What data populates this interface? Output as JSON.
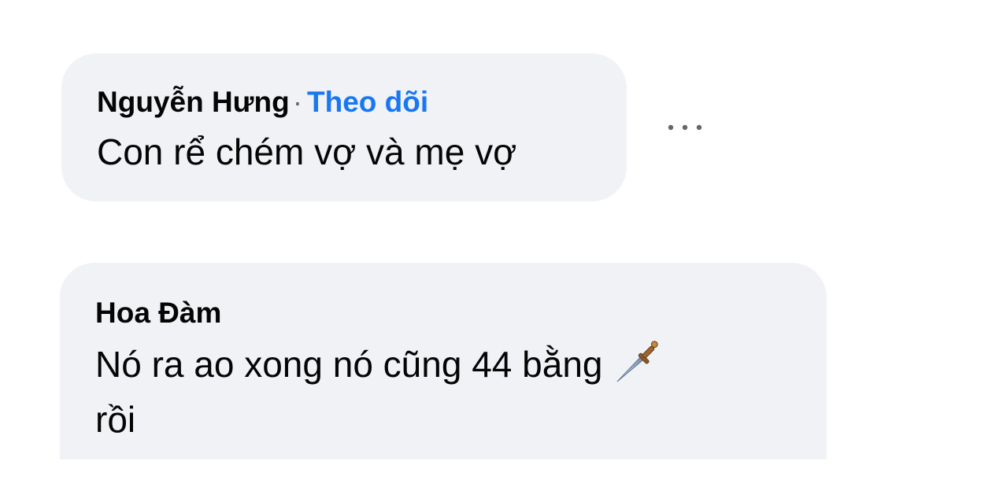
{
  "comments": [
    {
      "author": "Nguyễn Hưng",
      "separator": "·",
      "follow_label": "Theo dõi",
      "text": "Con rể chém vợ và mẹ vợ"
    },
    {
      "author": "Hoa Đàm",
      "text_line1": "Nó ra ao xong nó cũng 44 bằng",
      "emoji": "dagger-icon",
      "text_line2": "rồi"
    }
  ],
  "colors": {
    "bubble": "#f0f2f5",
    "link": "#1877f2",
    "text": "#050505",
    "muted": "#65676b"
  }
}
